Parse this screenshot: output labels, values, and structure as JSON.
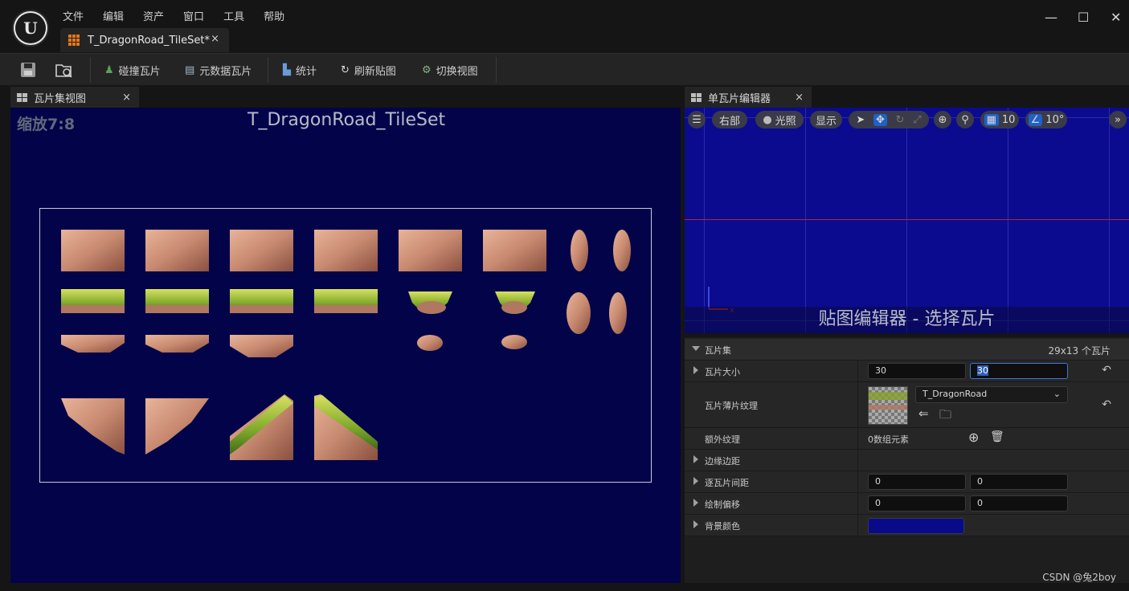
{
  "menu": {
    "file": "文件",
    "edit": "编辑",
    "asset": "资产",
    "window": "窗口",
    "tools": "工具",
    "help": "帮助"
  },
  "document_tab": {
    "label": "T_DragonRoad_TileSet*",
    "close": "×"
  },
  "toolbar": {
    "collision": "碰撞瓦片",
    "metadata": "元数据瓦片",
    "stats": "统计",
    "refresh": "刷新贴图",
    "switch_view": "切换视图"
  },
  "left_panel": {
    "tab": "瓦片集视图",
    "close": "×",
    "zoom": "缩放7:8",
    "title": "T_DragonRoad_TileSet"
  },
  "right_panel": {
    "tab": "单瓦片编辑器",
    "close": "×",
    "view_mode": "右部",
    "lighting": "光照",
    "show": "显示",
    "grid_snap": "10",
    "rot_snap": "10°",
    "caption": "贴图编辑器 - 选择瓦片"
  },
  "details": {
    "section": "瓦片集",
    "count": "29x13 个瓦片",
    "tile_size_label": "瓦片大小",
    "tile_size_x": "30",
    "tile_size_y": "30",
    "tile_sheet_label": "瓦片薄片纹理",
    "tile_sheet_value": "T_DragonRoad",
    "extra_textures_label": "额外纹理",
    "extra_textures_value": "0数组元素",
    "margin_label": "边缘边距",
    "spacing_label": "逐瓦片间距",
    "spacing_x": "0",
    "spacing_y": "0",
    "offset_label": "绘制偏移",
    "offset_x": "0",
    "offset_y": "0",
    "bg_color_label": "背景颜色",
    "bg_color": "#080a8a"
  },
  "colors": {
    "viewport_bg": "#03034a",
    "accent": "#e6761b",
    "snap_blue": "#2060c8"
  },
  "watermark": "CSDN @兔2boy"
}
